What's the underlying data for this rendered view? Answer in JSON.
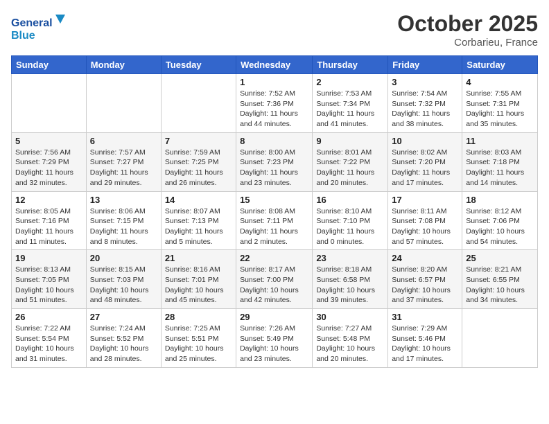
{
  "header": {
    "logo_general": "General",
    "logo_blue": "Blue",
    "month": "October 2025",
    "location": "Corbarieu, France"
  },
  "weekdays": [
    "Sunday",
    "Monday",
    "Tuesday",
    "Wednesday",
    "Thursday",
    "Friday",
    "Saturday"
  ],
  "weeks": [
    [
      {
        "day": "",
        "info": ""
      },
      {
        "day": "",
        "info": ""
      },
      {
        "day": "",
        "info": ""
      },
      {
        "day": "1",
        "info": "Sunrise: 7:52 AM\nSunset: 7:36 PM\nDaylight: 11 hours and 44 minutes."
      },
      {
        "day": "2",
        "info": "Sunrise: 7:53 AM\nSunset: 7:34 PM\nDaylight: 11 hours and 41 minutes."
      },
      {
        "day": "3",
        "info": "Sunrise: 7:54 AM\nSunset: 7:32 PM\nDaylight: 11 hours and 38 minutes."
      },
      {
        "day": "4",
        "info": "Sunrise: 7:55 AM\nSunset: 7:31 PM\nDaylight: 11 hours and 35 minutes."
      }
    ],
    [
      {
        "day": "5",
        "info": "Sunrise: 7:56 AM\nSunset: 7:29 PM\nDaylight: 11 hours and 32 minutes."
      },
      {
        "day": "6",
        "info": "Sunrise: 7:57 AM\nSunset: 7:27 PM\nDaylight: 11 hours and 29 minutes."
      },
      {
        "day": "7",
        "info": "Sunrise: 7:59 AM\nSunset: 7:25 PM\nDaylight: 11 hours and 26 minutes."
      },
      {
        "day": "8",
        "info": "Sunrise: 8:00 AM\nSunset: 7:23 PM\nDaylight: 11 hours and 23 minutes."
      },
      {
        "day": "9",
        "info": "Sunrise: 8:01 AM\nSunset: 7:22 PM\nDaylight: 11 hours and 20 minutes."
      },
      {
        "day": "10",
        "info": "Sunrise: 8:02 AM\nSunset: 7:20 PM\nDaylight: 11 hours and 17 minutes."
      },
      {
        "day": "11",
        "info": "Sunrise: 8:03 AM\nSunset: 7:18 PM\nDaylight: 11 hours and 14 minutes."
      }
    ],
    [
      {
        "day": "12",
        "info": "Sunrise: 8:05 AM\nSunset: 7:16 PM\nDaylight: 11 hours and 11 minutes."
      },
      {
        "day": "13",
        "info": "Sunrise: 8:06 AM\nSunset: 7:15 PM\nDaylight: 11 hours and 8 minutes."
      },
      {
        "day": "14",
        "info": "Sunrise: 8:07 AM\nSunset: 7:13 PM\nDaylight: 11 hours and 5 minutes."
      },
      {
        "day": "15",
        "info": "Sunrise: 8:08 AM\nSunset: 7:11 PM\nDaylight: 11 hours and 2 minutes."
      },
      {
        "day": "16",
        "info": "Sunrise: 8:10 AM\nSunset: 7:10 PM\nDaylight: 11 hours and 0 minutes."
      },
      {
        "day": "17",
        "info": "Sunrise: 8:11 AM\nSunset: 7:08 PM\nDaylight: 10 hours and 57 minutes."
      },
      {
        "day": "18",
        "info": "Sunrise: 8:12 AM\nSunset: 7:06 PM\nDaylight: 10 hours and 54 minutes."
      }
    ],
    [
      {
        "day": "19",
        "info": "Sunrise: 8:13 AM\nSunset: 7:05 PM\nDaylight: 10 hours and 51 minutes."
      },
      {
        "day": "20",
        "info": "Sunrise: 8:15 AM\nSunset: 7:03 PM\nDaylight: 10 hours and 48 minutes."
      },
      {
        "day": "21",
        "info": "Sunrise: 8:16 AM\nSunset: 7:01 PM\nDaylight: 10 hours and 45 minutes."
      },
      {
        "day": "22",
        "info": "Sunrise: 8:17 AM\nSunset: 7:00 PM\nDaylight: 10 hours and 42 minutes."
      },
      {
        "day": "23",
        "info": "Sunrise: 8:18 AM\nSunset: 6:58 PM\nDaylight: 10 hours and 39 minutes."
      },
      {
        "day": "24",
        "info": "Sunrise: 8:20 AM\nSunset: 6:57 PM\nDaylight: 10 hours and 37 minutes."
      },
      {
        "day": "25",
        "info": "Sunrise: 8:21 AM\nSunset: 6:55 PM\nDaylight: 10 hours and 34 minutes."
      }
    ],
    [
      {
        "day": "26",
        "info": "Sunrise: 7:22 AM\nSunset: 5:54 PM\nDaylight: 10 hours and 31 minutes."
      },
      {
        "day": "27",
        "info": "Sunrise: 7:24 AM\nSunset: 5:52 PM\nDaylight: 10 hours and 28 minutes."
      },
      {
        "day": "28",
        "info": "Sunrise: 7:25 AM\nSunset: 5:51 PM\nDaylight: 10 hours and 25 minutes."
      },
      {
        "day": "29",
        "info": "Sunrise: 7:26 AM\nSunset: 5:49 PM\nDaylight: 10 hours and 23 minutes."
      },
      {
        "day": "30",
        "info": "Sunrise: 7:27 AM\nSunset: 5:48 PM\nDaylight: 10 hours and 20 minutes."
      },
      {
        "day": "31",
        "info": "Sunrise: 7:29 AM\nSunset: 5:46 PM\nDaylight: 10 hours and 17 minutes."
      },
      {
        "day": "",
        "info": ""
      }
    ]
  ]
}
